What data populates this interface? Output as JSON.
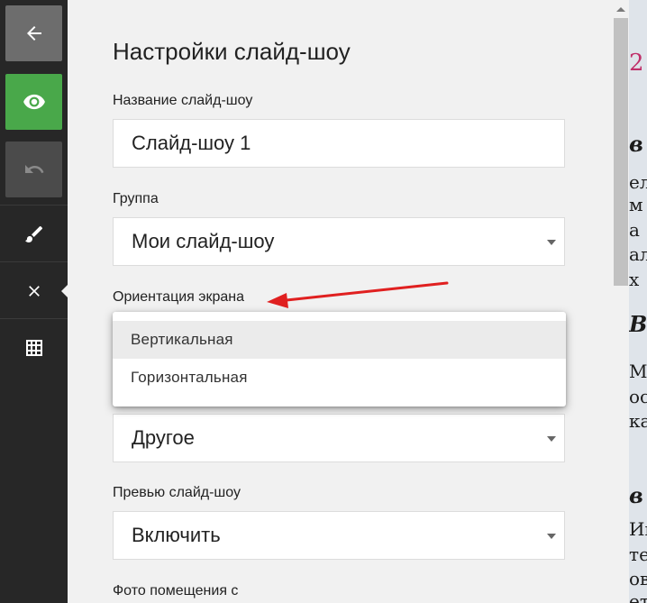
{
  "toolbar": {
    "back_icon": "arrow-left-icon",
    "preview_icon": "eye-icon",
    "undo_icon": "undo-icon",
    "brush_icon": "brush-icon",
    "close_icon": "close-icon",
    "grid_icon": "grid-icon",
    "colors": {
      "preview_bg": "#49a84a",
      "back_bg": "#6d6d6d",
      "toolbar_bg": "#272727"
    }
  },
  "panel": {
    "title": "Настройки слайд-шоу",
    "fields": {
      "name_label": "Название слайд-шоу",
      "name_value": "Слайд-шоу 1",
      "group_label": "Группа",
      "group_value": "Мои слайд-шоу",
      "orientation_label": "Ориентация экрана",
      "other_value": "Другое",
      "preview_label": "Превью слайд-шоу",
      "preview_value": "Включить",
      "photo_label": "Фото помещения с"
    },
    "orientation_dropdown": {
      "options": [
        "Вертикальная",
        "Горизонтальная"
      ],
      "highlighted": "Вертикальная"
    }
  },
  "annotation": {
    "color": "#e02020"
  },
  "background_strip": {
    "glyphs": [
      "в",
      "ел",
      "м",
      "а",
      "ал",
      "х",
      "В",
      "Ма",
      "ос",
      "ка",
      "в",
      "Ин",
      "те",
      "ов",
      "ет"
    ]
  }
}
